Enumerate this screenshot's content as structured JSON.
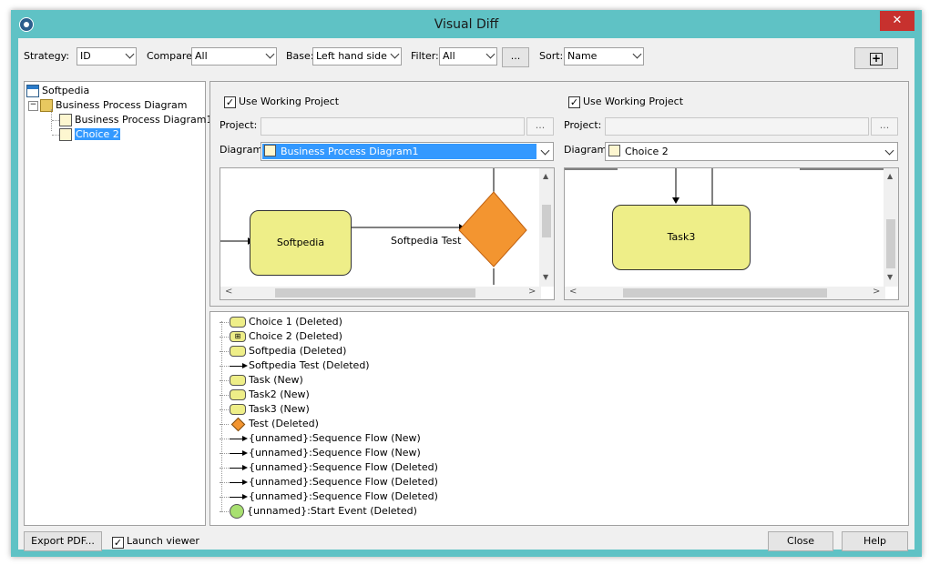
{
  "window": {
    "title": "Visual Diff",
    "close_glyph": "✕"
  },
  "toolbar": {
    "strategy_label": "Strategy:",
    "strategy_value": "ID",
    "compare_label": "Compare:",
    "compare_value": "All",
    "base_label": "Base:",
    "base_value": "Left hand side",
    "filter_label": "Filter:",
    "filter_value": "All",
    "filter_more": "...",
    "sort_label": "Sort:",
    "sort_value": "Name",
    "expand_glyph": "+"
  },
  "tree": {
    "root": "Softpedia",
    "folder": "Business Process Diagram",
    "items": [
      "Business Process Diagram1",
      "Choice 2"
    ]
  },
  "left_pane": {
    "use_working_project": "Use Working Project",
    "checked": true,
    "project_label": "Project:",
    "project_btn": "...",
    "diagram_label": "Diagram:",
    "diagram_value": "Business Process Diagram1",
    "shape_task": "Softpedia",
    "flow_label": "Softpedia Test"
  },
  "right_pane": {
    "use_working_project": "Use Working Project",
    "checked": true,
    "project_label": "Project:",
    "project_btn": "...",
    "diagram_label": "Diagram:",
    "diagram_value": "Choice 2",
    "shape_task": "Task3"
  },
  "changes": [
    {
      "icon": "task",
      "text": "Choice 1 (Deleted)"
    },
    {
      "icon": "choice",
      "text": "Choice 2 (Deleted)"
    },
    {
      "icon": "task",
      "text": "Softpedia (Deleted)"
    },
    {
      "icon": "flow",
      "text": "Softpedia Test (Deleted)"
    },
    {
      "icon": "task",
      "text": "Task (New)"
    },
    {
      "icon": "task",
      "text": "Task2 (New)"
    },
    {
      "icon": "task",
      "text": "Task3 (New)"
    },
    {
      "icon": "diamond",
      "text": "Test (Deleted)"
    },
    {
      "icon": "flow",
      "text": "{unnamed}:Sequence Flow (New)"
    },
    {
      "icon": "flow",
      "text": "{unnamed}:Sequence Flow (New)"
    },
    {
      "icon": "flow",
      "text": "{unnamed}:Sequence Flow (Deleted)"
    },
    {
      "icon": "flow",
      "text": "{unnamed}:Sequence Flow (Deleted)"
    },
    {
      "icon": "flow",
      "text": "{unnamed}:Sequence Flow (Deleted)"
    },
    {
      "icon": "circle",
      "text": "{unnamed}:Start Event (Deleted)"
    }
  ],
  "footer": {
    "export_btn": "Export PDF...",
    "launch_viewer": "Launch viewer",
    "launch_checked": true,
    "close_btn": "Close",
    "help_btn": "Help"
  },
  "colors": {
    "titlebar": "#5fc2c5",
    "selection": "#3399ff",
    "task_fill": "#eeee88",
    "diamond_fill": "#f39530"
  }
}
